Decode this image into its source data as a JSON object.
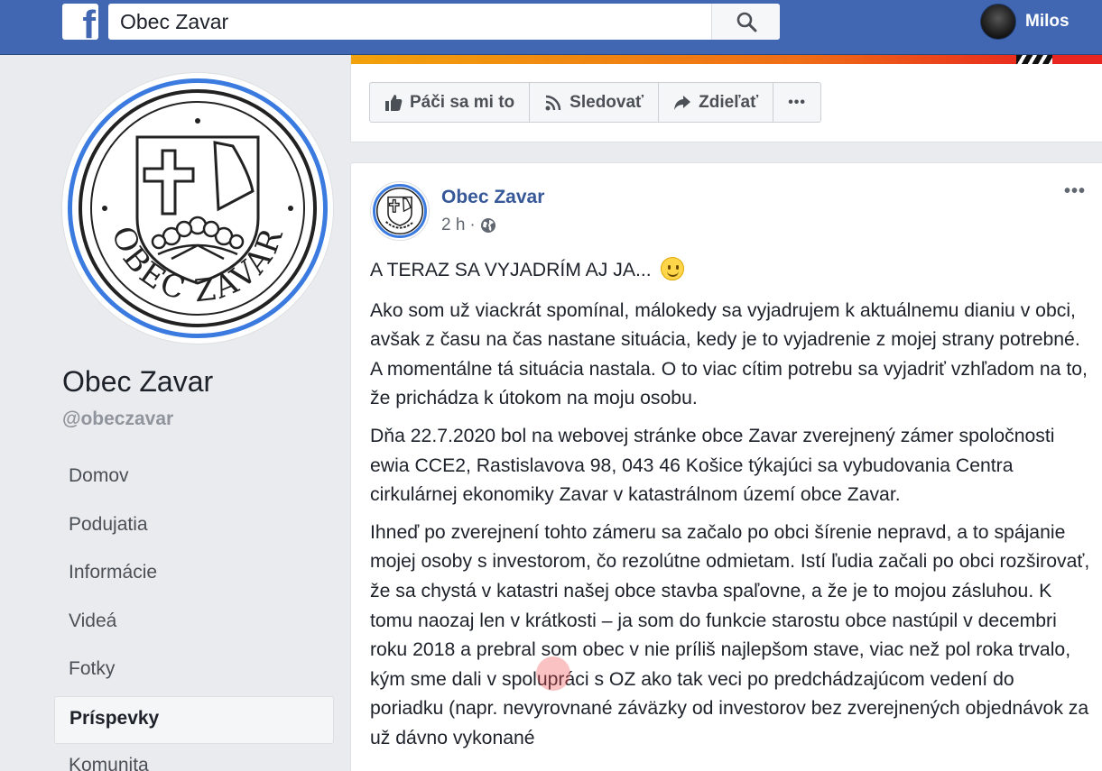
{
  "topbar": {
    "logo": "f",
    "search_value": "Obec Zavar",
    "user_name": "Milos"
  },
  "page": {
    "name": "Obec Zavar",
    "handle": "@obeczavar",
    "logo_text": "OBEC ZAVAR"
  },
  "nav": {
    "items": [
      {
        "label": "Domov"
      },
      {
        "label": "Podujatia"
      },
      {
        "label": "Informácie"
      },
      {
        "label": "Videá"
      },
      {
        "label": "Fotky"
      },
      {
        "label": "Príspevky"
      },
      {
        "label": "Komunita"
      }
    ]
  },
  "actions": {
    "like": "Páči sa mi to",
    "follow": "Sledovať",
    "share": "Zdieľať",
    "more": "•••"
  },
  "post": {
    "author": "Obec Zavar",
    "time": "2 h",
    "separator": "·",
    "menu": "•••",
    "headline": "A TERAZ SA VYJADRÍM AJ JA...",
    "paragraphs": [
      "Ako som už viackrát spomínal, málokedy sa vyjadrujem k aktuálnemu dianiu v obci, avšak z času na čas nastane situácia, kedy je to vyjadrenie z mojej strany potrebné. A momentálne tá situácia nastala. O to viac cítim potrebu sa vyjadriť vzhľadom na to, že prichádza k útokom na moju osobu.",
      "Dňa 22.7.2020 bol na webovej stránke obce Zavar zverejnený zámer spoločnosti ewia CCE2, Rastislavova 98, 043 46 Košice týkajúci sa vybudovania Centra cirkulárnej ekonomiky Zavar v katastrálnom území obce Zavar.",
      "Ihneď po zverejnení tohto zámeru sa začalo po obci šírenie nepravd, a to spájanie mojej osoby s investorom, čo rezolútne odmietam. Istí ľudia začali po obci rozširovať, že sa chystá v katastri našej obce stavba spaľovne, a že je to mojou zásluhou. K tomu naozaj len v krátkosti – ja som do funkcie starostu obce nastúpil v decembri roku 2018 a prebral som obec v nie príliš najlepšom stave, viac než pol roka trvalo, kým sme dali v spolupráci s OZ ako tak veci po predchádzajúcom vedení do poriadku (napr. nevyrovnané záväzky od investorov bez zverejnených objednávok za už dávno vykonané"
    ]
  },
  "colors": {
    "topbar": "#4267b2",
    "link": "#365899",
    "background": "#e9ebee"
  }
}
